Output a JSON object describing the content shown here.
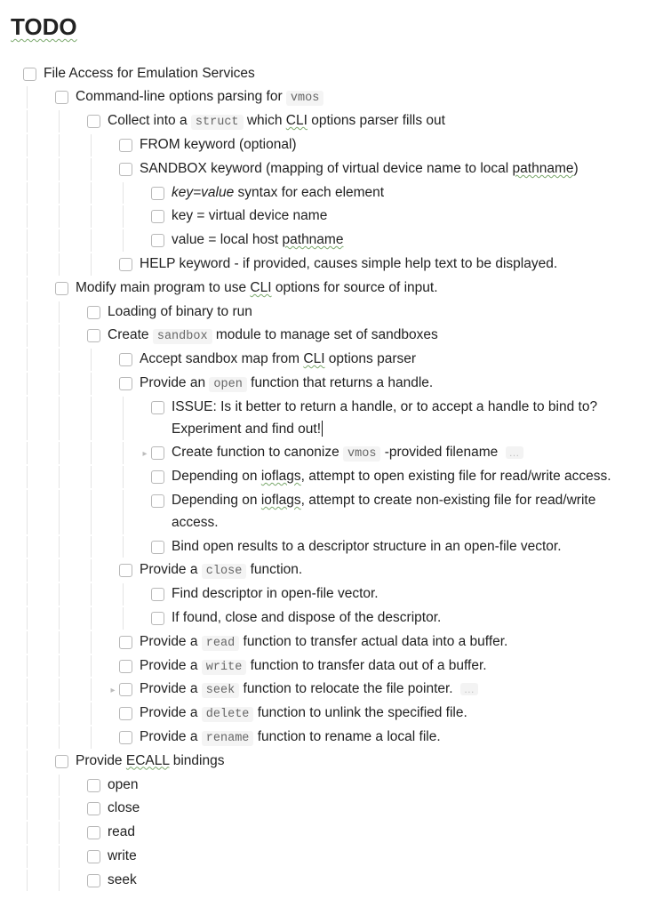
{
  "title": "TODO",
  "items": [
    {
      "indent": 0,
      "cb": true,
      "parts": [
        {
          "t": "text",
          "v": "File Access for Emulation Services"
        }
      ]
    },
    {
      "indent": 1,
      "cb": true,
      "parts": [
        {
          "t": "text",
          "v": "Command-line options parsing for "
        },
        {
          "t": "code",
          "v": "vmos"
        }
      ]
    },
    {
      "indent": 2,
      "cb": true,
      "parts": [
        {
          "t": "text",
          "v": "Collect into a "
        },
        {
          "t": "code",
          "v": "struct"
        },
        {
          "t": "text",
          "v": " which "
        },
        {
          "t": "wavy",
          "v": "CLI"
        },
        {
          "t": "text",
          "v": " options parser fills out"
        }
      ]
    },
    {
      "indent": 3,
      "cb": true,
      "parts": [
        {
          "t": "text",
          "v": "FROM keyword (optional)"
        }
      ]
    },
    {
      "indent": 3,
      "cb": true,
      "parts": [
        {
          "t": "text",
          "v": "SANDBOX keyword (mapping of virtual device name to local "
        },
        {
          "t": "wavy",
          "v": "pathname"
        },
        {
          "t": "text",
          "v": ")"
        }
      ]
    },
    {
      "indent": 4,
      "cb": true,
      "parts": [
        {
          "t": "em",
          "v": "key=value"
        },
        {
          "t": "text",
          "v": " syntax for each element"
        }
      ]
    },
    {
      "indent": 4,
      "cb": true,
      "parts": [
        {
          "t": "text",
          "v": "key = virtual device name"
        }
      ]
    },
    {
      "indent": 4,
      "cb": true,
      "parts": [
        {
          "t": "text",
          "v": "value = local host "
        },
        {
          "t": "wavy",
          "v": "pathname"
        }
      ]
    },
    {
      "indent": 3,
      "cb": true,
      "parts": [
        {
          "t": "text",
          "v": "HELP keyword - if provided, causes simple help text to be displayed."
        }
      ]
    },
    {
      "indent": 1,
      "cb": true,
      "parts": [
        {
          "t": "text",
          "v": "Modify main program to use "
        },
        {
          "t": "wavy",
          "v": "CLI"
        },
        {
          "t": "text",
          "v": " options for source of input."
        }
      ]
    },
    {
      "indent": 2,
      "cb": true,
      "parts": [
        {
          "t": "text",
          "v": "Loading of binary to run"
        }
      ]
    },
    {
      "indent": 2,
      "cb": true,
      "parts": [
        {
          "t": "text",
          "v": "Create "
        },
        {
          "t": "code",
          "v": "sandbox"
        },
        {
          "t": "text",
          "v": " module to manage set of sandboxes"
        }
      ]
    },
    {
      "indent": 3,
      "cb": true,
      "parts": [
        {
          "t": "text",
          "v": "Accept sandbox map from "
        },
        {
          "t": "wavy",
          "v": "CLI"
        },
        {
          "t": "text",
          "v": " options parser"
        }
      ]
    },
    {
      "indent": 3,
      "cb": true,
      "parts": [
        {
          "t": "text",
          "v": "Provide an "
        },
        {
          "t": "code",
          "v": "open"
        },
        {
          "t": "text",
          "v": " function that returns a handle."
        }
      ]
    },
    {
      "indent": 4,
      "cb": true,
      "parts": [
        {
          "t": "text",
          "v": "ISSUE: Is it better to return a handle, or to accept a handle to bind to?  Experiment and find out!"
        },
        {
          "t": "cursor"
        }
      ]
    },
    {
      "indent": 4,
      "cb": true,
      "toggle": "right",
      "parts": [
        {
          "t": "text",
          "v": "Create function to canonize "
        },
        {
          "t": "code",
          "v": "vmos"
        },
        {
          "t": "text",
          "v": " -provided filename "
        },
        {
          "t": "ellips",
          "v": "…"
        }
      ]
    },
    {
      "indent": 4,
      "cb": true,
      "parts": [
        {
          "t": "text",
          "v": "Depending on "
        },
        {
          "t": "wavy",
          "v": "ioflags"
        },
        {
          "t": "text",
          "v": ", attempt to open existing file for read/write access."
        }
      ]
    },
    {
      "indent": 4,
      "cb": true,
      "parts": [
        {
          "t": "text",
          "v": "Depending on "
        },
        {
          "t": "wavy",
          "v": "ioflags"
        },
        {
          "t": "text",
          "v": ", attempt to create non-existing file for read/write access."
        }
      ]
    },
    {
      "indent": 4,
      "cb": true,
      "parts": [
        {
          "t": "text",
          "v": "Bind open results to a descriptor structure in an open-file vector."
        }
      ]
    },
    {
      "indent": 3,
      "cb": true,
      "parts": [
        {
          "t": "text",
          "v": "Provide a "
        },
        {
          "t": "code",
          "v": "close"
        },
        {
          "t": "text",
          "v": " function."
        }
      ]
    },
    {
      "indent": 4,
      "cb": true,
      "parts": [
        {
          "t": "text",
          "v": "Find descriptor in open-file vector."
        }
      ]
    },
    {
      "indent": 4,
      "cb": true,
      "parts": [
        {
          "t": "text",
          "v": "If found, close and dispose of the descriptor."
        }
      ]
    },
    {
      "indent": 3,
      "cb": true,
      "parts": [
        {
          "t": "text",
          "v": "Provide a "
        },
        {
          "t": "code",
          "v": "read"
        },
        {
          "t": "text",
          "v": " function to transfer actual data into a buffer."
        }
      ]
    },
    {
      "indent": 3,
      "cb": true,
      "parts": [
        {
          "t": "text",
          "v": "Provide a "
        },
        {
          "t": "code",
          "v": "write"
        },
        {
          "t": "text",
          "v": " function to transfer data out of a buffer."
        }
      ]
    },
    {
      "indent": 3,
      "cb": true,
      "toggle": "right",
      "toggleLeft": true,
      "parts": [
        {
          "t": "text",
          "v": "Provide a "
        },
        {
          "t": "code",
          "v": "seek"
        },
        {
          "t": "text",
          "v": " function to relocate the file pointer. "
        },
        {
          "t": "ellips",
          "v": "…"
        }
      ]
    },
    {
      "indent": 3,
      "cb": true,
      "parts": [
        {
          "t": "text",
          "v": "Provide a "
        },
        {
          "t": "code",
          "v": "delete"
        },
        {
          "t": "text",
          "v": " function to unlink the specified file."
        }
      ]
    },
    {
      "indent": 3,
      "cb": true,
      "parts": [
        {
          "t": "text",
          "v": "Provide a "
        },
        {
          "t": "code",
          "v": "rename"
        },
        {
          "t": "text",
          "v": " function to rename a local file."
        }
      ]
    },
    {
      "indent": 1,
      "cb": true,
      "parts": [
        {
          "t": "text",
          "v": "Provide "
        },
        {
          "t": "wavy",
          "v": "ECALL"
        },
        {
          "t": "text",
          "v": " bindings"
        }
      ]
    },
    {
      "indent": 2,
      "cb": true,
      "parts": [
        {
          "t": "text",
          "v": "open"
        }
      ]
    },
    {
      "indent": 2,
      "cb": true,
      "parts": [
        {
          "t": "text",
          "v": "close"
        }
      ]
    },
    {
      "indent": 2,
      "cb": true,
      "parts": [
        {
          "t": "text",
          "v": "read"
        }
      ]
    },
    {
      "indent": 2,
      "cb": true,
      "parts": [
        {
          "t": "text",
          "v": "write"
        }
      ]
    },
    {
      "indent": 2,
      "cb": true,
      "parts": [
        {
          "t": "text",
          "v": "seek"
        }
      ]
    }
  ]
}
